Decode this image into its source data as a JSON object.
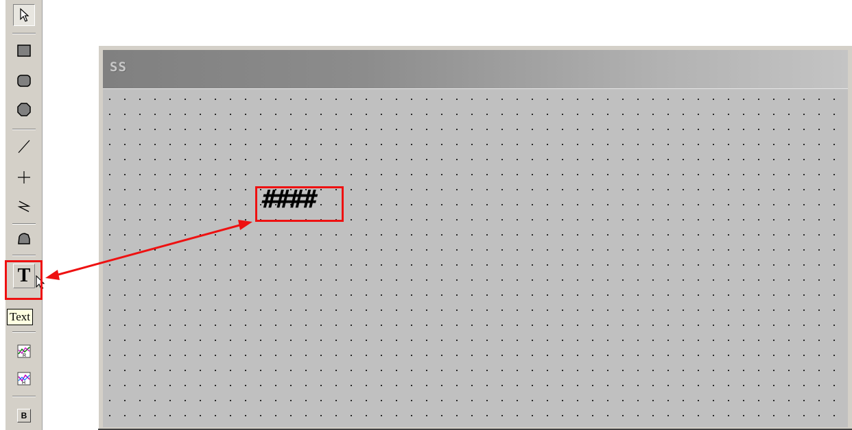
{
  "toolbar": {
    "tools": [
      {
        "name": "pointer",
        "icon": "arrow-cursor-icon"
      },
      {
        "name": "rectangle",
        "icon": "rectangle-icon"
      },
      {
        "name": "rounded-rectangle",
        "icon": "rounded-rectangle-icon"
      },
      {
        "name": "ellipse",
        "icon": "ellipse-icon"
      },
      {
        "name": "line",
        "icon": "line-icon"
      },
      {
        "name": "cross",
        "icon": "plus-icon"
      },
      {
        "name": "zigzag",
        "icon": "zigzag-line-icon"
      },
      {
        "name": "polygon",
        "icon": "polygon-icon"
      },
      {
        "name": "text",
        "icon": "text-t-icon",
        "label": "T"
      },
      {
        "name": "trend-r",
        "icon": "trend-r-icon"
      },
      {
        "name": "trend-h",
        "icon": "trend-h-icon"
      },
      {
        "name": "button",
        "icon": "button-b-icon",
        "label": "B"
      }
    ],
    "tooltip": "Text"
  },
  "window": {
    "title": "SS",
    "text_object": "####"
  },
  "annotation": {
    "color": "#ee1111"
  },
  "colors": {
    "palette_bg": "#d4d0c8",
    "canvas_bg": "#c0c0c0",
    "title_gradient_start": "#808080",
    "title_gradient_end": "#c4c4c4",
    "tooltip_bg": "#ffffe1"
  }
}
